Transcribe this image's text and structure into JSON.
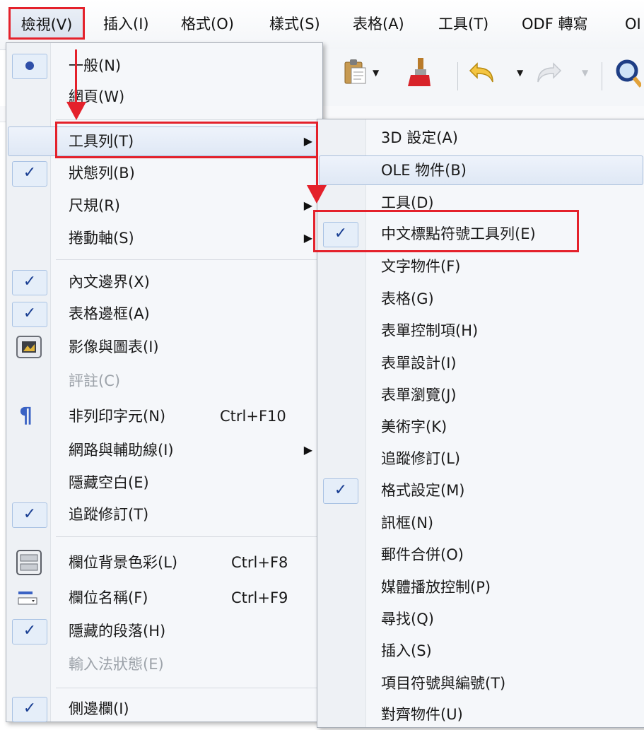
{
  "menubar": {
    "items": [
      "檢視(V)",
      "插入(I)",
      "格式(O)",
      "樣式(S)",
      "表格(A)",
      "工具(T)",
      "ODF 轉寫",
      "OI"
    ]
  },
  "view_menu": {
    "items": [
      {
        "label": "一般(N)",
        "icon": "radio-dot",
        "shortcut": "",
        "submenu": false,
        "checked": true
      },
      {
        "label": "網頁(W)",
        "icon": "",
        "shortcut": "",
        "submenu": false
      },
      {
        "label": "工具列(T)",
        "icon": "",
        "shortcut": "",
        "submenu": true
      },
      {
        "label": "狀態列(B)",
        "icon": "check",
        "shortcut": "",
        "submenu": false
      },
      {
        "label": "尺規(R)",
        "icon": "",
        "shortcut": "",
        "submenu": true
      },
      {
        "label": "捲動軸(S)",
        "icon": "",
        "shortcut": "",
        "submenu": true
      },
      {
        "label": "內文邊界(X)",
        "icon": "check",
        "shortcut": "",
        "submenu": false
      },
      {
        "label": "表格邊框(A)",
        "icon": "check",
        "shortcut": "",
        "submenu": false
      },
      {
        "label": "影像與圖表(I)",
        "icon": "image-icon",
        "shortcut": "",
        "submenu": false
      },
      {
        "label": "評註(C)",
        "icon": "",
        "shortcut": "",
        "submenu": false,
        "disabled": true
      },
      {
        "label": "非列印字元(N)",
        "icon": "pilcrow-icon",
        "shortcut": "Ctrl+F10",
        "submenu": false
      },
      {
        "label": "網路與輔助線(I)",
        "icon": "",
        "shortcut": "",
        "submenu": true
      },
      {
        "label": "隱藏空白(E)",
        "icon": "",
        "shortcut": "",
        "submenu": false
      },
      {
        "label": "追蹤修訂(T)",
        "icon": "check",
        "shortcut": "",
        "submenu": false
      },
      {
        "label": "欄位背景色彩(L)",
        "icon": "field-shading-icon",
        "shortcut": "Ctrl+F8",
        "submenu": false
      },
      {
        "label": "欄位名稱(F)",
        "icon": "field-name-icon",
        "shortcut": "Ctrl+F9",
        "submenu": false
      },
      {
        "label": "隱藏的段落(H)",
        "icon": "check",
        "shortcut": "",
        "submenu": false
      },
      {
        "label": "輸入法狀態(E)",
        "icon": "",
        "shortcut": "",
        "submenu": false,
        "disabled": true
      },
      {
        "label": "側邊欄(I)",
        "icon": "check",
        "shortcut": "",
        "submenu": false
      }
    ]
  },
  "toolbar_menu": {
    "items": [
      {
        "label": "3D 設定(A)",
        "checked": false
      },
      {
        "label": "OLE 物件(B)",
        "checked": false
      },
      {
        "label": "工具(D)",
        "checked": false
      },
      {
        "label": "中文標點符號工具列(E)",
        "checked": true
      },
      {
        "label": "文字物件(F)",
        "checked": false
      },
      {
        "label": "表格(G)",
        "checked": false
      },
      {
        "label": "表單控制項(H)",
        "checked": false
      },
      {
        "label": "表單設計(I)",
        "checked": false
      },
      {
        "label": "表單瀏覽(J)",
        "checked": false
      },
      {
        "label": "美術字(K)",
        "checked": false
      },
      {
        "label": "追蹤修訂(L)",
        "checked": false
      },
      {
        "label": "格式設定(M)",
        "checked": true
      },
      {
        "label": "訊框(N)",
        "checked": false
      },
      {
        "label": "郵件合併(O)",
        "checked": false
      },
      {
        "label": "媒體播放控制(P)",
        "checked": false
      },
      {
        "label": "尋找(Q)",
        "checked": false
      },
      {
        "label": "插入(S)",
        "checked": false
      },
      {
        "label": "項目符號與編號(T)",
        "checked": false
      },
      {
        "label": "對齊物件(U)",
        "checked": false
      }
    ]
  },
  "colors": {
    "annotation_red": "#e4212b",
    "check_blue": "#1a3f93",
    "menu_bg": "#f5f7fa"
  }
}
